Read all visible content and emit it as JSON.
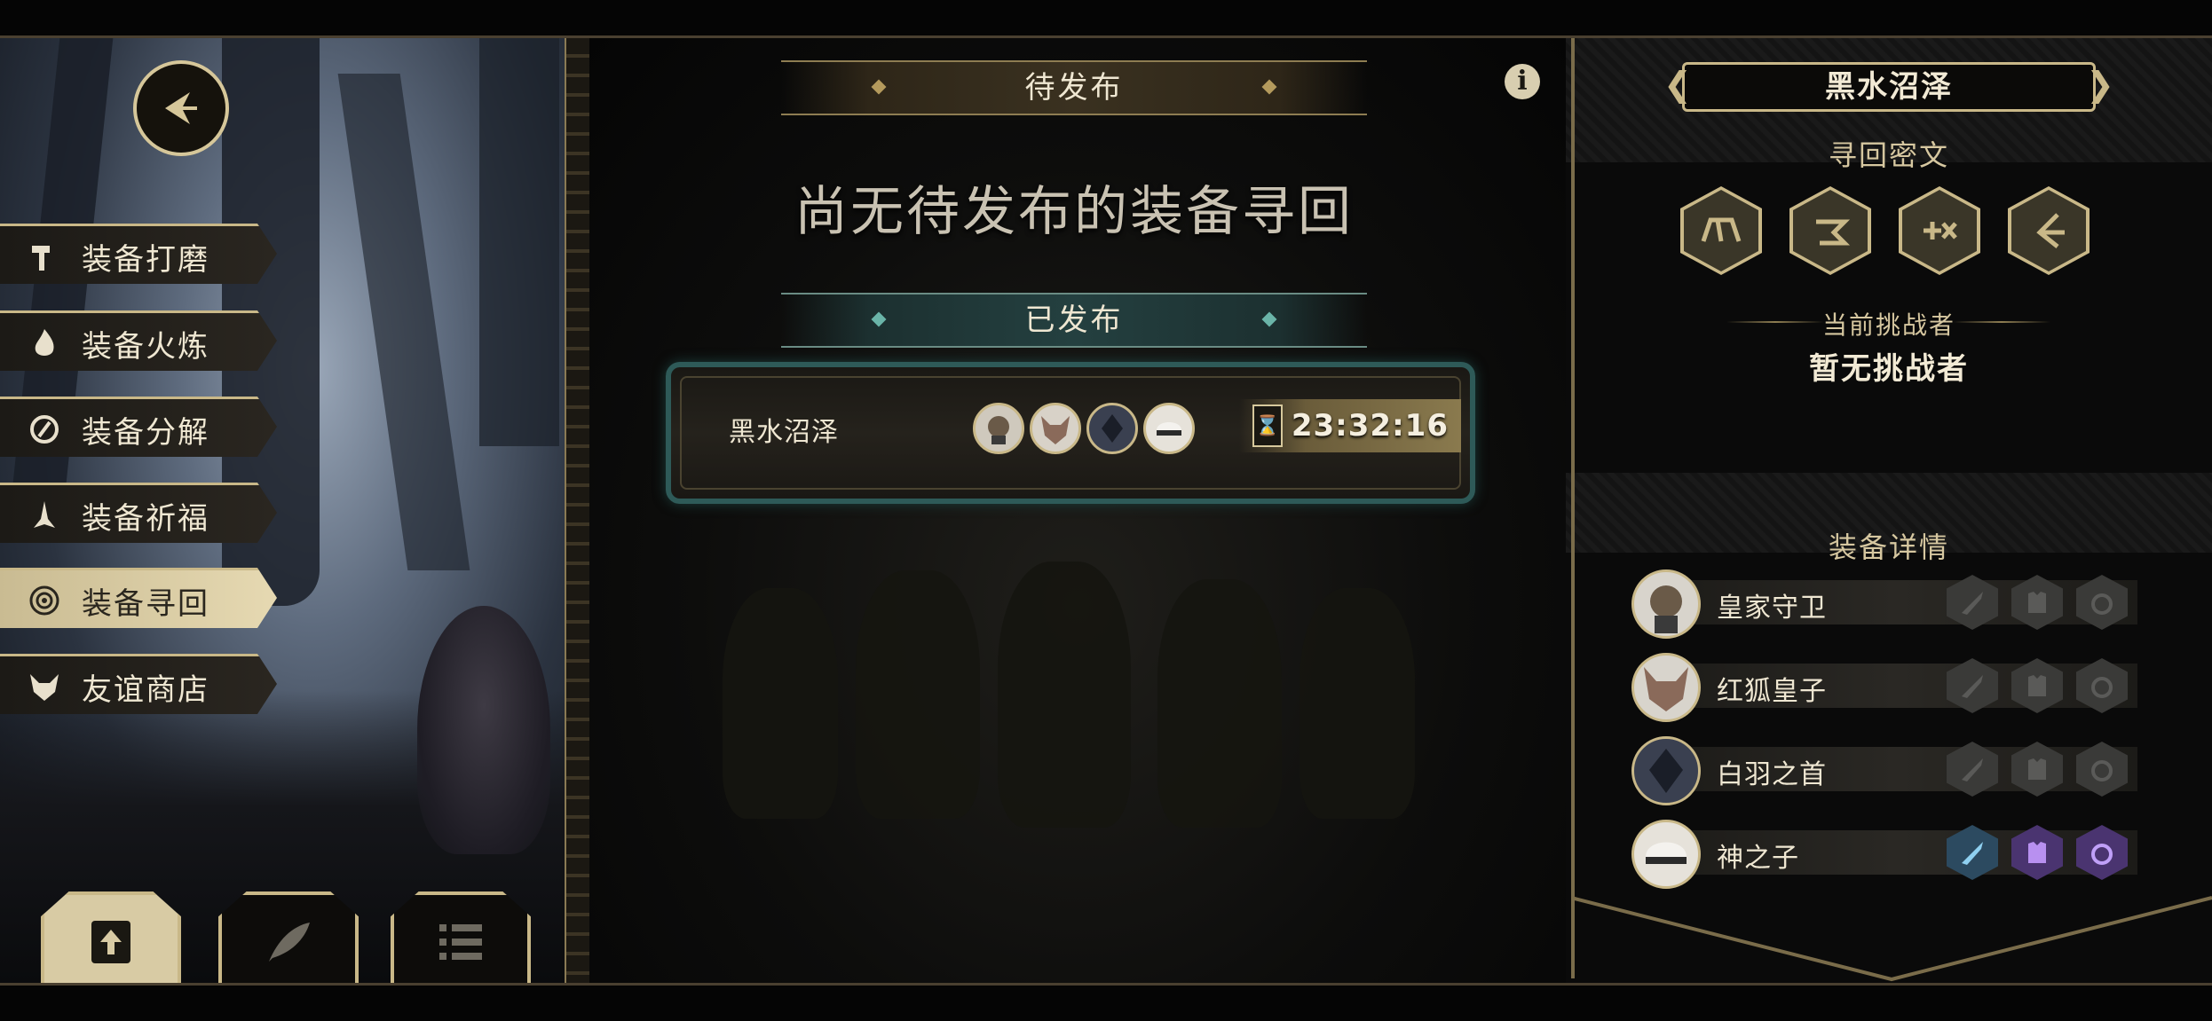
{
  "menu": {
    "items": [
      {
        "label": "装备打磨",
        "icon": "hammer-icon"
      },
      {
        "label": "装备火炼",
        "icon": "flame-icon"
      },
      {
        "label": "装备分解",
        "icon": "dismantle-icon"
      },
      {
        "label": "装备祈福",
        "icon": "pray-hands-icon"
      },
      {
        "label": "装备寻回",
        "icon": "target-icon",
        "active": true
      },
      {
        "label": "友谊商店",
        "icon": "fox-icon"
      }
    ]
  },
  "bottom_buttons": [
    "publish-icon",
    "feather-icon",
    "list-icon"
  ],
  "center": {
    "pending_label": "待发布",
    "empty_message": "尚无待发布的装备寻回",
    "published_label": "已发布",
    "published_card": {
      "title": "黑水沼泽",
      "timer": "23:32:16",
      "avatars": [
        "guard-avatar",
        "fox-avatar",
        "feather-avatar",
        "helmet-avatar"
      ]
    }
  },
  "right": {
    "region_title": "黑水沼泽",
    "runes_label": "寻回密文",
    "runes": [
      "rune-1-icon",
      "rune-2-icon",
      "rune-3-icon",
      "rune-4-icon"
    ],
    "challenger_label": "当前挑战者",
    "challenger_value": "暂无挑战者",
    "equip_label": "装备详情",
    "equip_rows": [
      {
        "name": "皇家守卫",
        "slots_lit": false
      },
      {
        "name": "红狐皇子",
        "slots_lit": false
      },
      {
        "name": "白羽之首",
        "slots_lit": false
      },
      {
        "name": "神之子",
        "slots_lit": true
      }
    ]
  },
  "colors": {
    "gold": "#c9b888",
    "teal": "#2e5a58",
    "active_menu": "#e6d9b2"
  }
}
